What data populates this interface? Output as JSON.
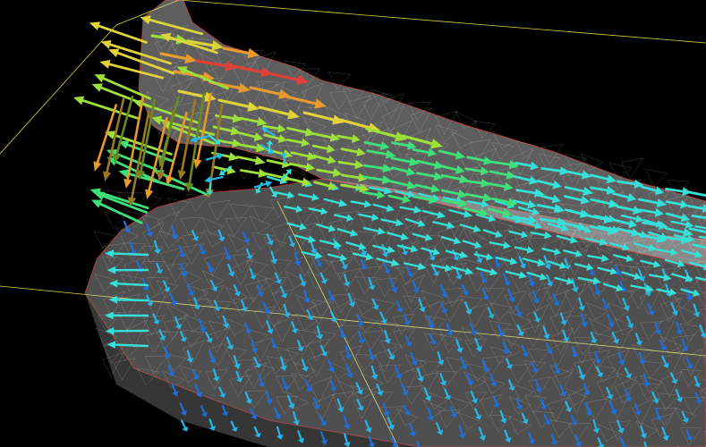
{
  "scene": {
    "kind": "3d-vector-field-visualization",
    "background_color": "#000000",
    "bounding_box_color": "#ffff44",
    "mesh_color": "#d0d0d0",
    "mesh_edge_color": "#ff4040",
    "colormap": [
      "#1e6fd9",
      "#26b6e8",
      "#35e0d8",
      "#3ee07a",
      "#9ee03a",
      "#e0d23a",
      "#e89a2e",
      "#e0403a"
    ]
  }
}
